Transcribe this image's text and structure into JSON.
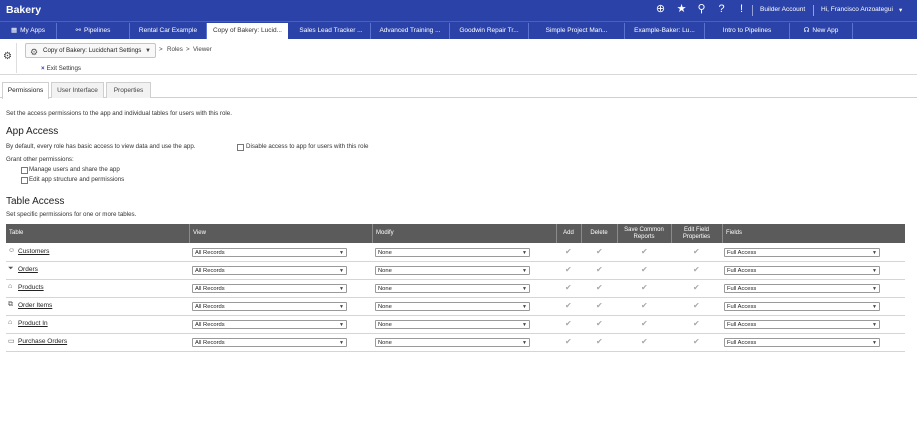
{
  "header": {
    "app_title": "Bakery",
    "icons": [
      "plus-circle-icon",
      "star-icon",
      "search-icon",
      "help-icon",
      "alert-icon"
    ],
    "builder_account": "Builder Account",
    "greeting": "Hi, Francisco Anzoategui",
    "menu_caret": "▾"
  },
  "apps_tabs": [
    {
      "label": "My Apps",
      "icon": "grid-icon"
    },
    {
      "label": "Pipelines",
      "icon": "pipelines-icon"
    },
    {
      "label": "Rental Car Example"
    },
    {
      "label": "Copy of Bakery: Lucid..."
    },
    {
      "label": "Sales Lead Tracker ..."
    },
    {
      "label": "Advanced Training ..."
    },
    {
      "label": "Goodwin Repair Tr..."
    },
    {
      "label": "Simple Project Man..."
    },
    {
      "label": "Example-Baker: Lu..."
    },
    {
      "label": "Intro to Pipelines"
    },
    {
      "label": "New App",
      "icon": "new-app-icon"
    }
  ],
  "settings": {
    "app_dropdown": "Copy of Bakery: Lucidchart Settings",
    "breadcrumb_sep": ">",
    "breadcrumb_roles": "Roles",
    "breadcrumb_viewer": "Viewer",
    "exit_label": "Exit Settings"
  },
  "subtabs": [
    "Permissions",
    "User Interface",
    "Properties"
  ],
  "permissions": {
    "intro": "Set the access permissions to the app and individual tables for users with this role.",
    "app_access_title": "App Access",
    "basic_access": "By default, every role has basic access to view data and use the app.",
    "disable_access": "Disable access to app for users with this role",
    "grant_other": "Grant other permissions:",
    "manage_users": "Manage users and share the app",
    "edit_structure": "Edit app structure and permissions",
    "table_access_title": "Table Access",
    "table_access_sub": "Set specific permissions for one or more tables."
  },
  "table": {
    "headers": {
      "table": "Table",
      "view": "View",
      "modify": "Modify",
      "add": "Add",
      "delete": "Delete",
      "save_reports": "Save Common Reports",
      "edit_field": "Edit Field Properties",
      "fields": "Fields"
    },
    "rows": [
      {
        "name": "Customers",
        "icon": "smiley-icon",
        "view": "All Records",
        "modify": "None",
        "fields": "Full Access"
      },
      {
        "name": "Orders",
        "icon": "funnel-icon",
        "view": "All Records",
        "modify": "None",
        "fields": "Full Access"
      },
      {
        "name": "Products",
        "icon": "bag-icon",
        "view": "All Records",
        "modify": "None",
        "fields": "Full Access"
      },
      {
        "name": "Order Items",
        "icon": "tags-icon",
        "view": "All Records",
        "modify": "None",
        "fields": "Full Access"
      },
      {
        "name": "Product In",
        "icon": "bag-icon",
        "view": "All Records",
        "modify": "None",
        "fields": "Full Access"
      },
      {
        "name": "Purchase Orders",
        "icon": "folder-icon",
        "view": "All Records",
        "modify": "None",
        "fields": "Full Access"
      }
    ]
  },
  "colors": {
    "brand": "#2b43a8",
    "table_header": "#5b5b5b",
    "check_disabled": "#a8a8a8"
  }
}
